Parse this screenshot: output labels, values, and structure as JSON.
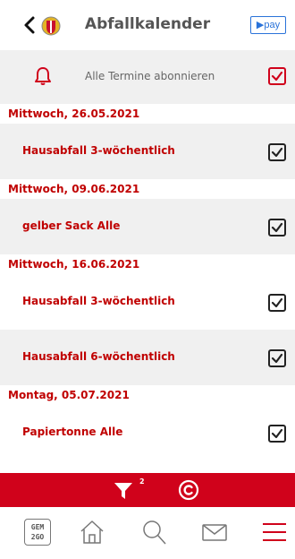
{
  "header": {
    "title": "Abfallkalender",
    "pay_label": "▶pay",
    "back_icon": "chevron-left-icon",
    "crest_icon": "coat-of-arms-icon"
  },
  "subscribe": {
    "label": "Alle Termine abonnieren",
    "checked": true,
    "icon": "bell-icon"
  },
  "entries": [
    {
      "date": "Mittwoch, 26.05.2021",
      "items": [
        {
          "label": "Hausabfall 3-wöchentlich",
          "checked": true
        }
      ]
    },
    {
      "date": "Mittwoch, 09.06.2021",
      "items": [
        {
          "label": "gelber Sack Alle",
          "checked": true
        }
      ]
    },
    {
      "date": "Mittwoch, 16.06.2021",
      "items": [
        {
          "label": "Hausabfall 3-wöchentlich",
          "checked": true
        },
        {
          "label": "Hausabfall 6-wöchentlich",
          "checked": true
        }
      ]
    },
    {
      "date": "Montag, 05.07.2021",
      "items": [
        {
          "label": "Papiertonne Alle",
          "checked": true
        }
      ]
    }
  ],
  "filter_bar": {
    "filter_count": "2",
    "filter_icon": "funnel-icon",
    "copyright_icon": "copyright-icon"
  },
  "bottom_nav": {
    "logo_text": "GEM\n2GO",
    "items": [
      "gem2go-logo",
      "home-icon",
      "search-icon",
      "mail-icon",
      "menu-icon"
    ]
  },
  "colors": {
    "accent": "#d0021b",
    "text_red": "#c00000",
    "row_gray": "#f0f0f0",
    "pay_blue": "#2a73d9"
  }
}
